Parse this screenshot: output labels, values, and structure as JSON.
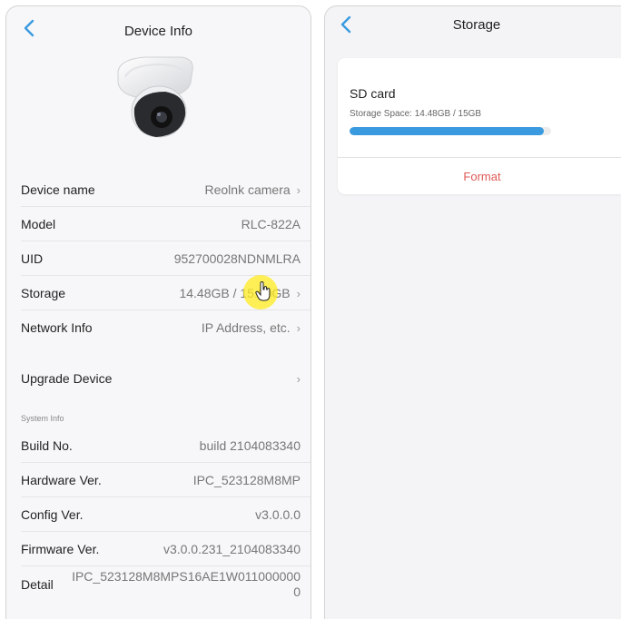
{
  "device_info": {
    "title": "Device Info",
    "rows": [
      {
        "label": "Device name",
        "value": "Reolnk camera",
        "chevron": true
      },
      {
        "label": "Model",
        "value": "RLC-822A",
        "chevron": false
      },
      {
        "label": "UID",
        "value": "952700028NDNMLRA",
        "chevron": false
      },
      {
        "label": "Storage",
        "value": "14.48GB / 15.00GB",
        "chevron": true
      },
      {
        "label": "Network Info",
        "value": "IP Address, etc.",
        "chevron": true
      }
    ],
    "upgrade": {
      "label": "Upgrade Device"
    },
    "system_info_label": "System Info",
    "system_rows": [
      {
        "label": "Build No.",
        "value": "build 2104083340"
      },
      {
        "label": "Hardware Ver.",
        "value": "IPC_523128M8MP"
      },
      {
        "label": "Config Ver.",
        "value": "v3.0.0.0"
      },
      {
        "label": "Firmware Ver.",
        "value": "v3.0.0.231_2104083340"
      },
      {
        "label": "Detail",
        "value": "IPC_523128M8MPS16AE1W0110000000"
      }
    ]
  },
  "storage": {
    "title": "Storage",
    "card_title": "SD card",
    "storage_space": "Storage Space: 14.48GB / 15GB",
    "used_fraction": 0.965,
    "format_label": "Format"
  },
  "icons": {
    "back": "chevron-left-icon",
    "row_chevron": "chevron-right-icon",
    "cursor": "hand-pointer-icon"
  },
  "colors": {
    "accent_blue": "#3a9ae0",
    "format_red": "#e05a55",
    "cursor_highlight": "#ffec1e"
  }
}
